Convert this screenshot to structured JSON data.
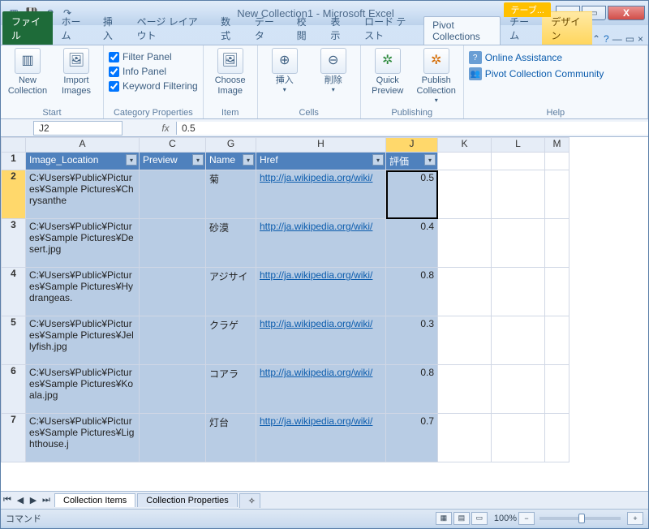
{
  "title": "New Collection1 - Microsoft Excel",
  "context_tab": "テーブ...",
  "win": {
    "min": "—",
    "max": "▭",
    "close": "X"
  },
  "tabs": {
    "file": "ファイル",
    "items": [
      "ホーム",
      "挿入",
      "ページ レイアウト",
      "数式",
      "データ",
      "校閲",
      "表示",
      "ロード テスト"
    ],
    "active": "Pivot Collections",
    "after": [
      "チーム"
    ],
    "design": "デザイン"
  },
  "ribbon": {
    "start": {
      "label": "Start",
      "new": "New Collection",
      "import": "Import Images"
    },
    "cat": {
      "label": "Category Properties",
      "filter": "Filter Panel",
      "info": "Info Panel",
      "keyword": "Keyword Filtering"
    },
    "item": {
      "label": "Item",
      "choose": "Choose Image"
    },
    "cells": {
      "label": "Cells",
      "insert": "挿入",
      "delete": "削除"
    },
    "pub": {
      "label": "Publishing",
      "quick": "Quick Preview",
      "publish": "Publish Collection"
    },
    "help": {
      "label": "Help",
      "online": "Online Assistance",
      "community": "Pivot Collection Community"
    }
  },
  "fx": {
    "name": "J2",
    "value": "0.5"
  },
  "cols": {
    "A": "A",
    "C": "C",
    "G": "G",
    "H": "H",
    "J": "J",
    "K": "K",
    "L": "L",
    "M": "M"
  },
  "headers": {
    "loc": "Image_Location",
    "prev": "Preview",
    "name": "Name",
    "href": "Href",
    "rate": "評価"
  },
  "rows": [
    {
      "n": 2,
      "loc": "C:¥Users¥Public¥Pictures¥Sample Pictures¥Chrysanthe",
      "name": "菊",
      "href": "http://ja.wikipedia.org/wiki/",
      "rate": "0.5",
      "c1": "#e85a16",
      "c2": "#ffb347"
    },
    {
      "n": 3,
      "loc": "C:¥Users¥Public¥Pictures¥Sample Pictures¥Desert.jpg",
      "name": "砂漠",
      "href": "http://ja.wikipedia.org/wiki/",
      "rate": "0.4",
      "c1": "#5a8fd6",
      "c2": "#c77b3f"
    },
    {
      "n": 4,
      "loc": "C:¥Users¥Public¥Pictures¥Sample Pictures¥Hydrangeas.",
      "name": "アジサイ",
      "href": "http://ja.wikipedia.org/wiki/",
      "rate": "0.8",
      "c1": "#3b7b2e",
      "c2": "#a6c3e6"
    },
    {
      "n": 5,
      "loc": "C:¥Users¥Public¥Pictures¥Sample Pictures¥Jellyfish.jpg",
      "name": "クラゲ",
      "href": "http://ja.wikipedia.org/wiki/",
      "rate": "0.3",
      "c1": "#1a2b3d",
      "c2": "#f5b942"
    },
    {
      "n": 6,
      "loc": "C:¥Users¥Public¥Pictures¥Sample Pictures¥Koala.jpg",
      "name": "コアラ",
      "href": "http://ja.wikipedia.org/wiki/",
      "rate": "0.8",
      "c1": "#9aa7ad",
      "c2": "#4a5c63"
    },
    {
      "n": 7,
      "loc": "C:¥Users¥Public¥Pictures¥Sample Pictures¥Lighthouse.j",
      "name": "灯台",
      "href": "http://ja.wikipedia.org/wiki/",
      "rate": "0.7",
      "c1": "#6fa7d8",
      "c2": "#3a5d3a"
    }
  ],
  "sheets": {
    "a": "Collection Items",
    "b": "Collection Properties"
  },
  "status": {
    "mode": "コマンド",
    "zoom": "100%"
  }
}
